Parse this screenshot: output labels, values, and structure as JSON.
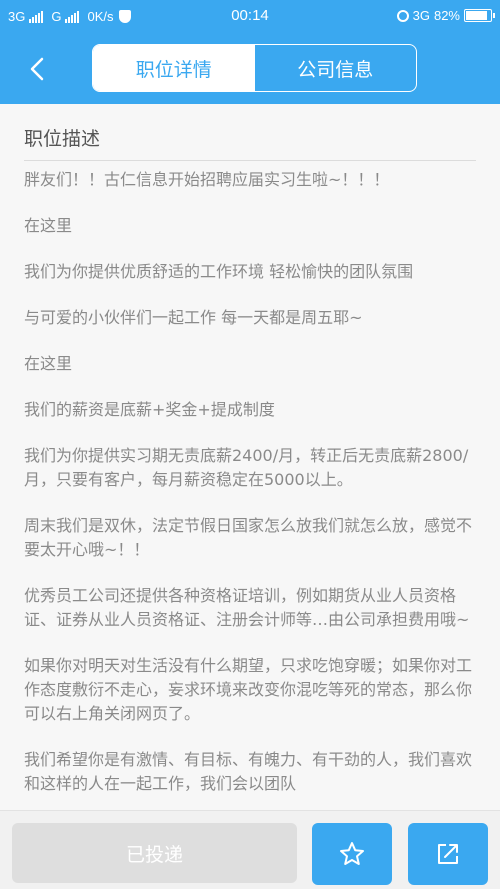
{
  "status_bar": {
    "network1": "3G",
    "network2": "G",
    "speed": "0K/s",
    "time": "00:14",
    "network3": "3G",
    "battery_percent": "82%",
    "battery_level": 0.82
  },
  "nav": {
    "tabs": [
      {
        "label": "职位详情",
        "active": true
      },
      {
        "label": "公司信息",
        "active": false
      }
    ]
  },
  "section": {
    "title": "职位描述",
    "paragraphs": [
      "胖友们！！古仁信息开始招聘应届实习生啦~！！！",
      "在这里",
      "我们为你提供优质舒适的工作环境 轻松愉快的团队氛围",
      "与可爱的小伙伴们一起工作 每一天都是周五耶~",
      "在这里",
      "我们的薪资是底薪+奖金+提成制度",
      "我们为你提供实习期无责底薪2400/月，转正后无责底薪2800/月，只要有客户，每月薪资稳定在5000以上。",
      "周末我们是双休，法定节假日国家怎么放我们就怎么放，感觉不要太开心哦~！！",
      "优秀员工公司还提供各种资格证培训，例如期货从业人员资格证、证券从业人员资格证、注册会计师等…由公司承担费用哦~",
      "如果你对明天对生活没有什么期望，只求吃饱穿暖；如果你对工作态度敷衍不走心，妄求环境来改变你混吃等死的常态，那么你可以右上角关闭网页了。",
      "我们希望你是有激情、有目标、有魄力、有干劲的人，我们喜欢和这样的人在一起工作，我们会以团队"
    ]
  },
  "bottom": {
    "applied_label": "已投递"
  },
  "icons": {
    "back": "chevron-left-icon",
    "favorite": "star-icon",
    "share": "share-icon"
  },
  "colors": {
    "primary": "#3aa8f0",
    "disabled": "#dedede",
    "text": "#8a8a8a"
  }
}
